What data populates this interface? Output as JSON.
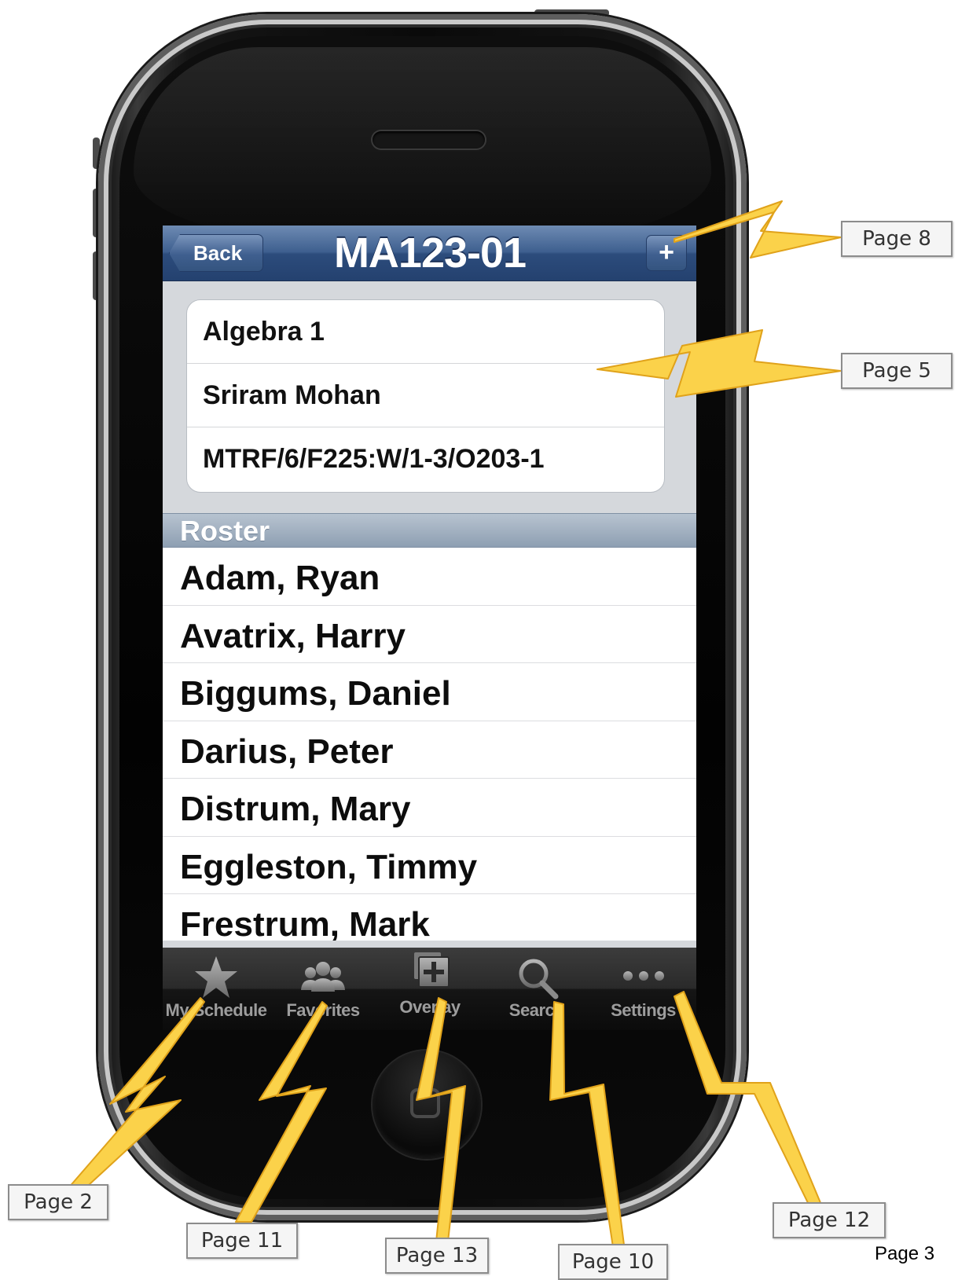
{
  "nav": {
    "back_label": "Back",
    "title": "MA123-01",
    "add_label": "+"
  },
  "course_info": [
    {
      "text": "Algebra 1"
    },
    {
      "text": "Sriram Mohan"
    },
    {
      "text": "MTRF/6/F225:W/1-3/O203-1"
    }
  ],
  "roster": {
    "header": "Roster",
    "students": [
      "Adam, Ryan",
      "Avatrix, Harry",
      "Biggums, Daniel",
      "Darius, Peter",
      "Distrum, Mary",
      "Eggleston, Timmy",
      "Frestrum, Mark"
    ]
  },
  "tabs": [
    {
      "label": "My Schedule",
      "icon": "star-icon"
    },
    {
      "label": "Favorites",
      "icon": "people-icon"
    },
    {
      "label": "Overlay",
      "icon": "overlay-plus-icon"
    },
    {
      "label": "Search",
      "icon": "magnifier-icon"
    },
    {
      "label": "Settings",
      "icon": "more-dots-icon"
    }
  ],
  "callouts": {
    "page8": "Page 8",
    "page5": "Page 5",
    "page2": "Page 2",
    "page11": "Page 11",
    "page13": "Page 13",
    "page10": "Page 10",
    "page12": "Page 12"
  },
  "page_label": "Page 3",
  "colors": {
    "bolt_fill": "#fbd24a",
    "bolt_stroke": "#e0a21a",
    "nav_blue": "#2c4c7c",
    "tab_dark": "#151515"
  }
}
